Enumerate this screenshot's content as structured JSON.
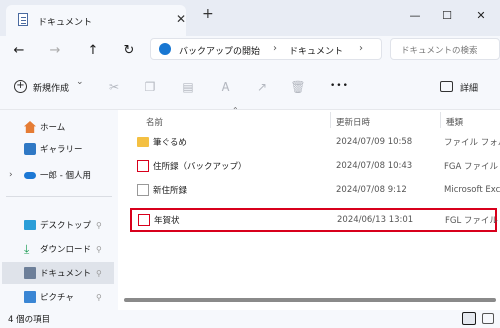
{
  "window": {
    "tab_title": "ドキュメント",
    "tab_close": "✕",
    "tab_add": "+",
    "minimize": "—",
    "maximize": "☐",
    "close": "✕"
  },
  "nav": {
    "back": "←",
    "forward": "→",
    "up": "↑",
    "refresh": "↻",
    "breadcrumb": [
      "バックアップの開始",
      "ドキュメント"
    ],
    "separator": "›",
    "search_placeholder": "ドキュメントの検索"
  },
  "toolbar": {
    "new_label": "新規作成",
    "new_chevron": "⌄",
    "more": "•••",
    "details_label": "詳細"
  },
  "sidebar": {
    "items": [
      {
        "label": "ホーム"
      },
      {
        "label": "ギャラリー"
      },
      {
        "label": "一郎 - 個人用"
      },
      {
        "label": "デスクトップ"
      },
      {
        "label": "ダウンロード"
      },
      {
        "label": "ドキュメント"
      },
      {
        "label": "ピクチャ"
      }
    ],
    "expand_chevron": "›",
    "pin": "📌"
  },
  "columns": {
    "name": "名前",
    "date": "更新日時",
    "type": "種類"
  },
  "files": [
    {
      "name": "筆ぐるめ",
      "date": "2024/07/09 10:58",
      "type": "ファイル フォルダー",
      "icon": "folder"
    },
    {
      "name": "住所録（バックアップ）",
      "date": "2024/07/08 10:43",
      "type": "FGA ファイル",
      "icon": "fga"
    },
    {
      "name": "新住所録",
      "date": "2024/07/08 9:12",
      "type": "Microsoft Excel",
      "icon": "excel"
    },
    {
      "name": "年賀状",
      "date": "2024/06/13 13:01",
      "type": "FGL ファイル",
      "icon": "fgl"
    }
  ],
  "status": {
    "item_count": "4 個の項目"
  },
  "colors": {
    "highlight": "#d8001c",
    "accent": "#0067c0"
  }
}
